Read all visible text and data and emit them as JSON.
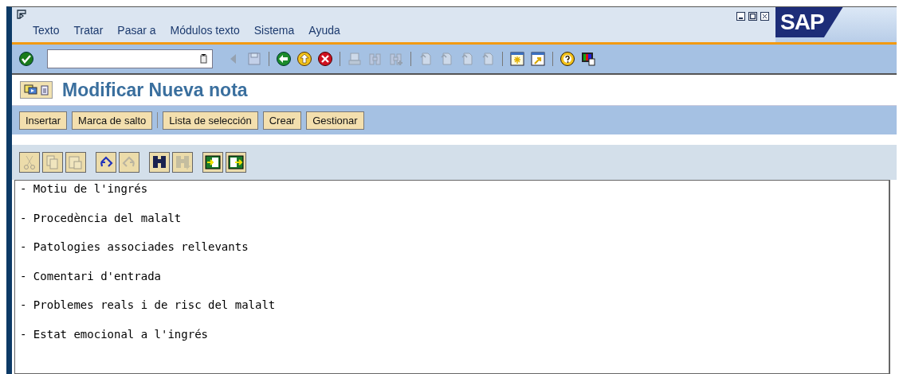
{
  "menu": [
    "Texto",
    "Tratar",
    "Pasar a",
    "Módulos texto",
    "Sistema",
    "Ayuda"
  ],
  "system_toolbar": [
    {
      "kind": "enter",
      "disabled": false
    },
    {
      "kind": "command"
    },
    {
      "kind": "prev",
      "disabled": true
    },
    {
      "kind": "save",
      "disabled": true
    },
    {
      "kind": "sep"
    },
    {
      "kind": "back",
      "disabled": false
    },
    {
      "kind": "exit",
      "disabled": false
    },
    {
      "kind": "cancel",
      "disabled": false
    },
    {
      "kind": "sep"
    },
    {
      "kind": "print",
      "disabled": true
    },
    {
      "kind": "find",
      "disabled": true
    },
    {
      "kind": "findnext",
      "disabled": true
    },
    {
      "kind": "sep"
    },
    {
      "kind": "page",
      "disabled": true
    },
    {
      "kind": "page",
      "disabled": true
    },
    {
      "kind": "page",
      "disabled": true
    },
    {
      "kind": "page",
      "disabled": true
    },
    {
      "kind": "sep"
    },
    {
      "kind": "session",
      "disabled": false
    },
    {
      "kind": "shortcut",
      "disabled": false
    },
    {
      "kind": "sep"
    },
    {
      "kind": "help",
      "disabled": false
    },
    {
      "kind": "layout",
      "disabled": false
    }
  ],
  "logo": "SAP",
  "title": "Modificar Nueva nota",
  "app_toolbar": [
    {
      "label": "Insertar",
      "kind": "button"
    },
    {
      "label": "Marca de salto",
      "kind": "button"
    },
    {
      "kind": "sep"
    },
    {
      "label": "Lista de selección",
      "kind": "button"
    },
    {
      "label": "Crear",
      "kind": "button"
    },
    {
      "label": "Gestionar",
      "kind": "button"
    }
  ],
  "editor_toolbar": [
    {
      "kind": "cut",
      "disabled": true
    },
    {
      "kind": "copy",
      "disabled": true
    },
    {
      "kind": "paste",
      "disabled": true
    },
    {
      "kind": "gap"
    },
    {
      "kind": "undo",
      "disabled": false
    },
    {
      "kind": "redo",
      "disabled": true
    },
    {
      "kind": "gap"
    },
    {
      "kind": "find",
      "disabled": false
    },
    {
      "kind": "findnext",
      "disabled": true
    },
    {
      "kind": "gap"
    },
    {
      "kind": "import",
      "disabled": false
    },
    {
      "kind": "export",
      "disabled": false
    }
  ],
  "editor_lines": [
    "- Motiu de l'ingrés",
    "- Procedència del malalt",
    "- Patologies associades rellevants",
    "- Comentari d'entrada",
    "- Problemes reals i de risc del malalt",
    "- Estat emocional a l'ingrés"
  ]
}
